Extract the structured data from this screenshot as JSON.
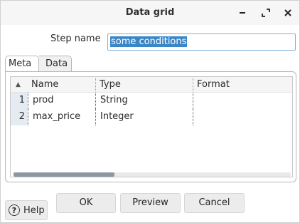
{
  "window": {
    "title": "Data grid",
    "controls": [
      "minimize-icon",
      "maximize-icon",
      "close-icon"
    ]
  },
  "step": {
    "label": "Step name",
    "value": "some conditions"
  },
  "tabs": [
    {
      "label": "Meta",
      "active": true
    },
    {
      "label": "Data",
      "active": false
    }
  ],
  "grid": {
    "sort_indicator": "▲",
    "columns": [
      "Name",
      "Type",
      "Format"
    ],
    "rows": [
      {
        "num": "1",
        "name": "prod",
        "type": "String",
        "format": ""
      },
      {
        "num": "2",
        "name": "max_price",
        "type": "Integer",
        "format": ""
      }
    ],
    "scroll_position": 0.0
  },
  "buttons": {
    "ok": "OK",
    "preview": "Preview",
    "cancel": "Cancel",
    "help": "Help"
  },
  "colors": {
    "selection": "#3a86c6",
    "rownum_bg": "#e4ebf2",
    "input_border": "#7fb0da",
    "scroll_thumb": "#8c97a3"
  }
}
